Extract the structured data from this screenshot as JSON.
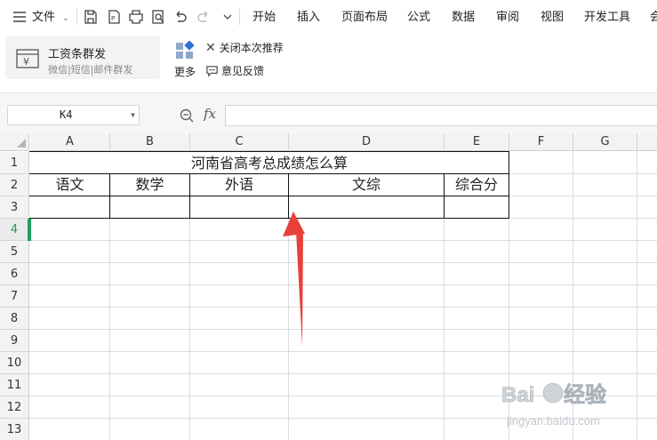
{
  "menubar": {
    "file_label": "文件",
    "tabs": [
      "开始",
      "插入",
      "页面布局",
      "公式",
      "数据",
      "审阅",
      "视图",
      "开发工具",
      "会"
    ]
  },
  "ribbon": {
    "promo_title": "工资条群发",
    "promo_subtitle": "微信|短信|邮件群发",
    "more_label": "更多",
    "close_recommend_label": "关闭本次推荐",
    "feedback_label": "意见反馈"
  },
  "formula_bar": {
    "name_box_value": "K4",
    "fx_label": "fx",
    "formula_value": ""
  },
  "grid": {
    "columns": [
      "A",
      "B",
      "C",
      "D",
      "E",
      "F",
      "G"
    ],
    "rows": [
      "1",
      "2",
      "3",
      "4",
      "5",
      "6",
      "7",
      "8",
      "9",
      "10",
      "11",
      "12",
      "13"
    ],
    "active_row": "4"
  },
  "table": {
    "title": "河南省高考总成绩怎么算",
    "headers": [
      "语文",
      "数学",
      "外语",
      "文综",
      "综合分"
    ]
  },
  "watermark": {
    "brand": "Baidu经验",
    "url": "jingyan.baidu.com"
  },
  "colors": {
    "accent_green": "#1e9d5a",
    "arrow_red": "#e8403a",
    "gridline": "#dadce0"
  }
}
